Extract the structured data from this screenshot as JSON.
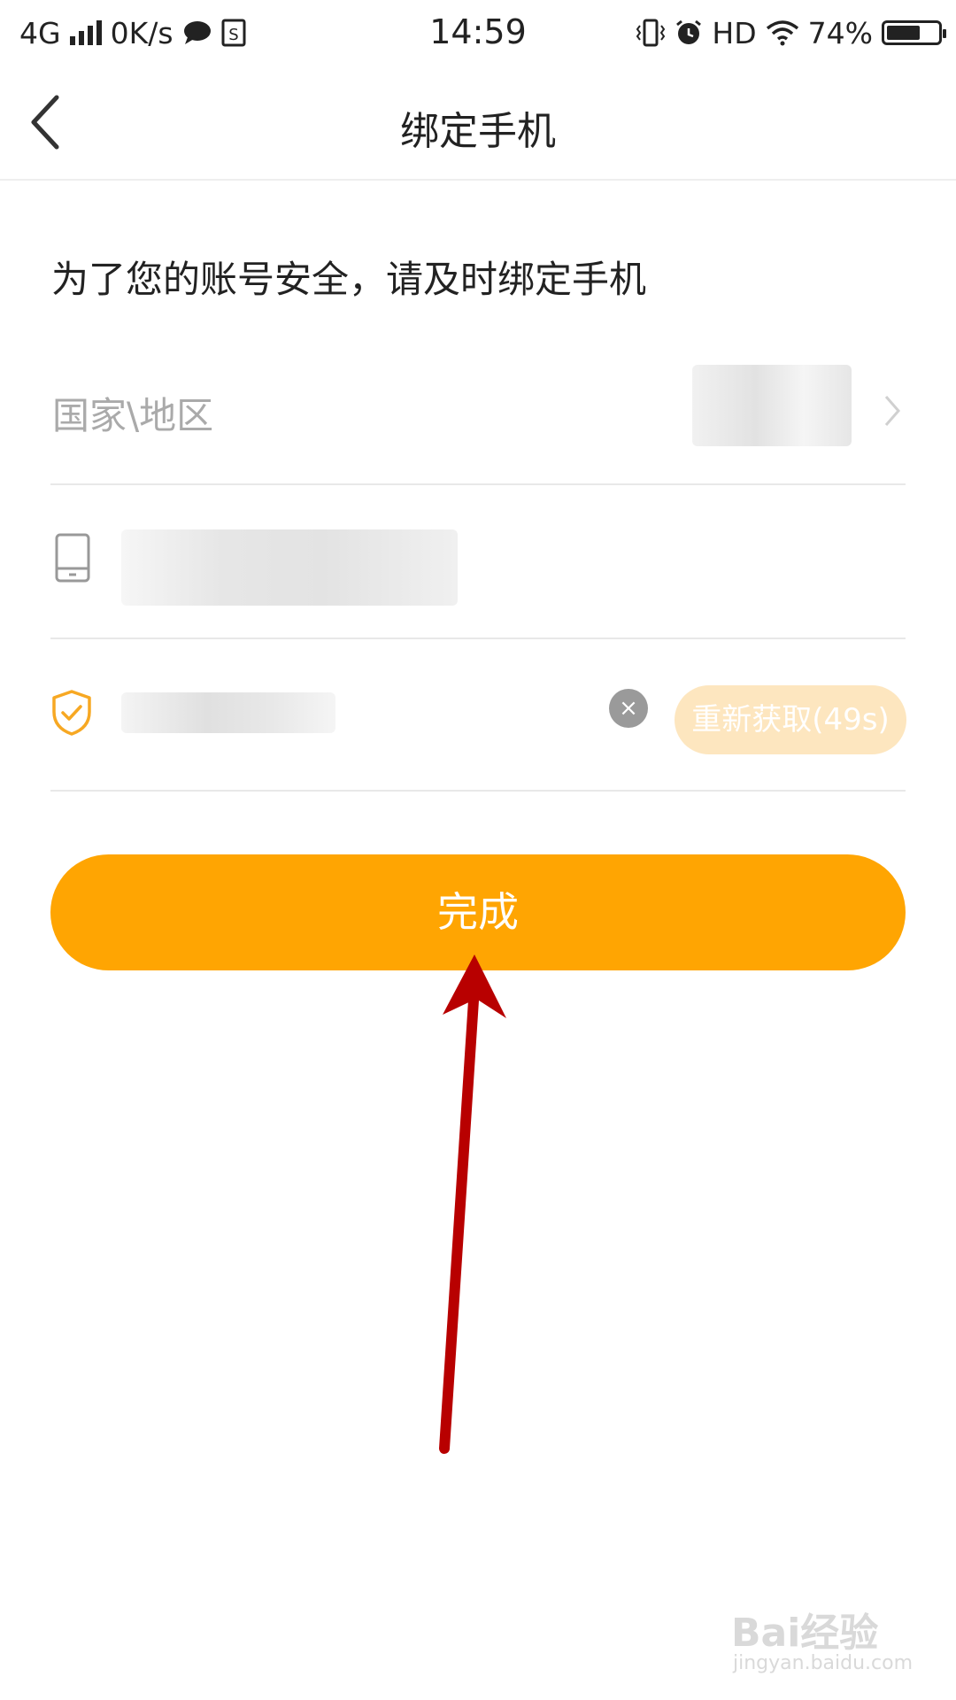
{
  "status_bar": {
    "network": "4G",
    "speed": "0K/s",
    "time": "14:59",
    "hd": "HD",
    "battery": "74%",
    "battery_level": 0.74
  },
  "nav": {
    "title": "绑定手机",
    "back_icon": "chevron-left-icon"
  },
  "intro": "为了您的账号安全，请及时绑定手机",
  "form": {
    "country_label": "国家\\地区",
    "phone_icon": "phone-icon",
    "code_icon": "shield-check-icon",
    "clear_icon": "close-icon",
    "clear_label": "×",
    "resend_label": "重新获取(49s)"
  },
  "done_button": "完成",
  "watermark": {
    "logo": "Bai经验",
    "url": "jingyan.baidu.com"
  },
  "colors": {
    "accent": "#ffa502",
    "resend_bg": "#fde6bf",
    "arrow": "#b80000"
  }
}
